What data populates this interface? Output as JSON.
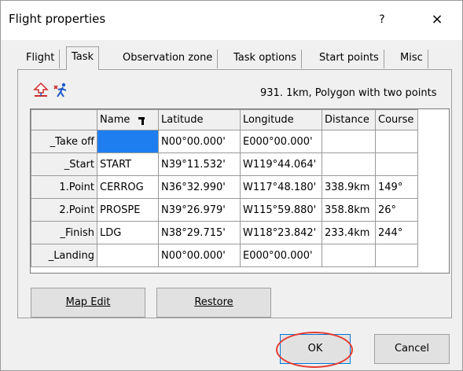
{
  "window": {
    "title": "Flight properties",
    "help_label": "?",
    "close_label": "×"
  },
  "tabs": [
    {
      "label": "Flight"
    },
    {
      "label": "Task"
    },
    {
      "label": "Observation zone"
    },
    {
      "label": "Task options"
    },
    {
      "label": "Start points"
    },
    {
      "label": "Misc"
    }
  ],
  "task": {
    "summary": "931. 1km, Polygon with two points",
    "columns": [
      "",
      "Name",
      "Latitude",
      "Longitude",
      "Distance",
      "Course"
    ],
    "rows": [
      {
        "label": "_Take off",
        "name": "",
        "lat": "N00°00.000'",
        "lon": "E000°00.000'",
        "dist": "",
        "course": ""
      },
      {
        "label": "_Start",
        "name": "START",
        "lat": "N39°11.532'",
        "lon": "W119°44.064'",
        "dist": "",
        "course": ""
      },
      {
        "label": "1.Point",
        "name": "CERROG",
        "lat": "N36°32.990'",
        "lon": "W117°48.180'",
        "dist": "338.9km",
        "course": "149°"
      },
      {
        "label": "2.Point",
        "name": "PROSPE",
        "lat": "N39°26.979'",
        "lon": "W115°59.880'",
        "dist": "358.8km",
        "course": "26°"
      },
      {
        "label": "_Finish",
        "name": "LDG",
        "lat": "N38°29.715'",
        "lon": "W118°23.842'",
        "dist": "233.4km",
        "course": "244°"
      },
      {
        "label": "_Landing",
        "name": "",
        "lat": "N00°00.000'",
        "lon": "E000°00.000'",
        "dist": "",
        "course": ""
      }
    ]
  },
  "buttons": {
    "map_edit": "Map Edit",
    "restore": "Restore",
    "ok": "OK",
    "cancel": "Cancel"
  },
  "colors": {
    "selection": "#1e7ef0",
    "highlight_ring": "#e53a2f",
    "icon": "#1a56c8",
    "icon_red": "#d12a2a"
  }
}
